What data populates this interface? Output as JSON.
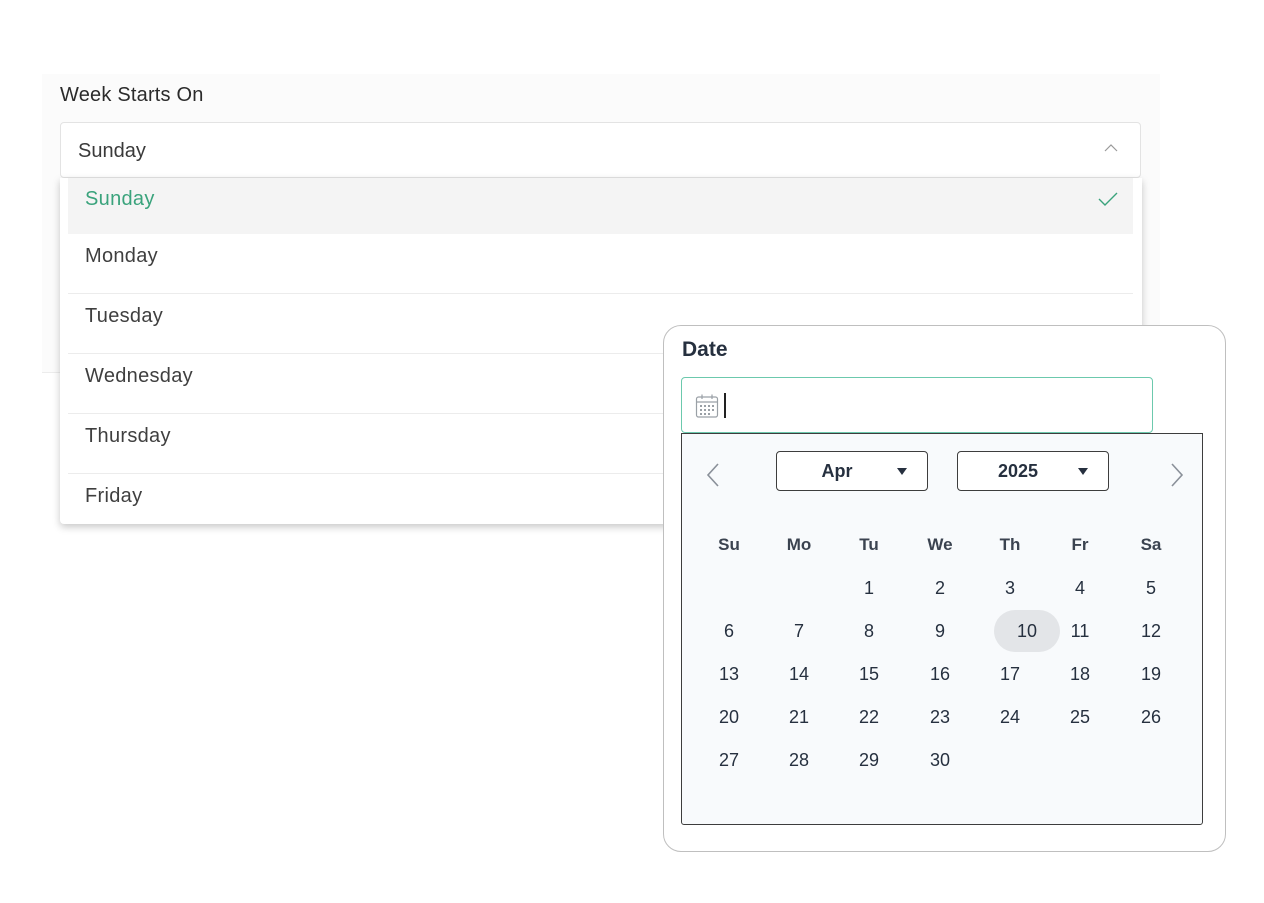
{
  "week_start": {
    "label": "Week Starts On",
    "selected_value": "Sunday",
    "options": [
      {
        "label": "Sunday",
        "selected": true
      },
      {
        "label": "Monday",
        "selected": false
      },
      {
        "label": "Tuesday",
        "selected": false
      },
      {
        "label": "Wednesday",
        "selected": false
      },
      {
        "label": "Thursday",
        "selected": false
      },
      {
        "label": "Friday",
        "selected": false
      }
    ],
    "accent_color": "#3aa37c"
  },
  "date_picker": {
    "label": "Date",
    "input_value": "",
    "month": "Apr",
    "year": "2025",
    "weekdays": [
      "Su",
      "Mo",
      "Tu",
      "We",
      "Th",
      "Fr",
      "Sa"
    ],
    "weeks": [
      [
        "",
        "",
        "1",
        "2",
        "3",
        "4",
        "5"
      ],
      [
        "6",
        "7",
        "8",
        "9",
        "10",
        "11",
        "12"
      ],
      [
        "13",
        "14",
        "15",
        "16",
        "17",
        "18",
        "19"
      ],
      [
        "20",
        "21",
        "22",
        "23",
        "24",
        "25",
        "26"
      ],
      [
        "27",
        "28",
        "29",
        "30",
        "",
        "",
        ""
      ]
    ],
    "highlighted_day": "10",
    "focus_color": "#6cc9ad"
  }
}
